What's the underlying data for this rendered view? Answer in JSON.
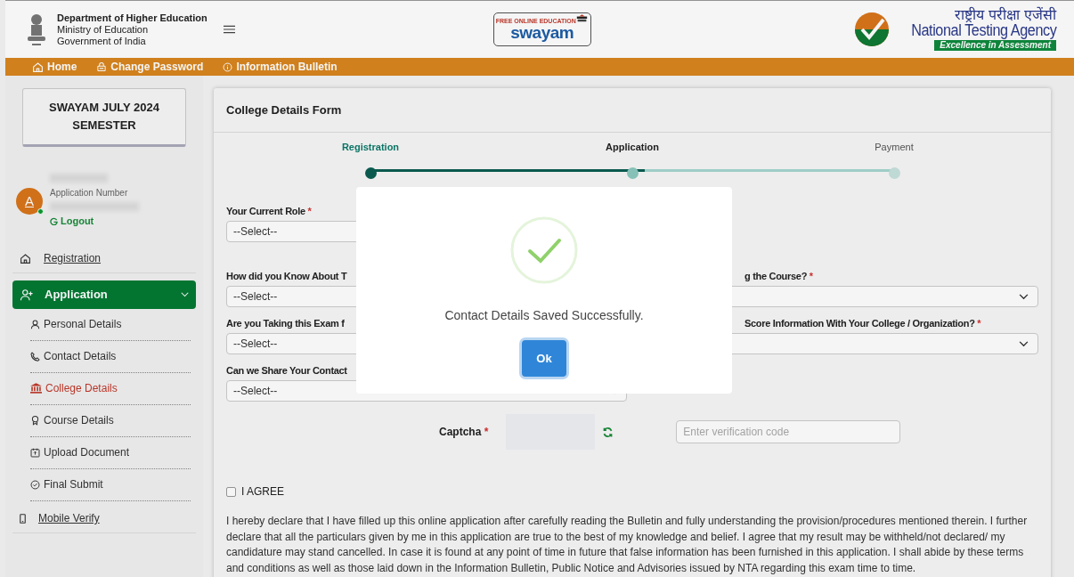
{
  "header": {
    "department": "Department of Higher Education",
    "ministry": "Ministry of Education",
    "government": "Government of India",
    "swayam_tagline": "FREE ONLINE EDUCATION",
    "swayam_name": "swayam",
    "nta_hindi": "राष्ट्रीय परीक्षा एजेंसी",
    "nta_name": "National Testing Agency",
    "nta_motto": "Excellence in Assessment"
  },
  "top_nav": [
    {
      "label": "Home"
    },
    {
      "label": "Change Password"
    },
    {
      "label": "Information Bulletin"
    }
  ],
  "sidebar": {
    "session": "SWAYAM JULY 2024 SEMESTER",
    "avatar_letter": "A",
    "online": true,
    "application_number_label": "Application Number",
    "logout": "Logout",
    "items": [
      {
        "label": "Registration",
        "selected": false
      },
      {
        "label": "Application",
        "selected": true,
        "expanded": true,
        "children": [
          {
            "label": "Personal Details",
            "selected": false
          },
          {
            "label": "Contact Details",
            "selected": false
          },
          {
            "label": "College Details",
            "selected": true
          },
          {
            "label": "Course Details",
            "selected": false
          },
          {
            "label": "Upload Document",
            "selected": false
          },
          {
            "label": "Final Submit",
            "selected": false
          }
        ]
      },
      {
        "label": "Mobile Verify",
        "selected": false
      }
    ]
  },
  "form": {
    "title": "College Details Form",
    "steps": [
      {
        "label": "Registration",
        "done": true,
        "selected": false
      },
      {
        "label": "Application",
        "done": false,
        "selected": true
      },
      {
        "label": "Payment",
        "done": false,
        "selected": false
      }
    ],
    "rows": [
      {
        "left_label": "Your Current Role",
        "left_mark": "*",
        "left_value": "--Select--"
      },
      {
        "left_label": "How did you Know About T",
        "left_value": "--Select--",
        "right_label": "g the Course?",
        "right_mark": "*"
      },
      {
        "left_label": "Are you Taking this Exam f",
        "left_value": "--Select--",
        "right_label": "Score Information With Your College / Organization?",
        "right_mark": "*"
      },
      {
        "left_label": "Can we Share Your Contact",
        "left_value": "--Select--"
      }
    ],
    "captcha_label": "Captcha",
    "captcha_mark": "*",
    "captcha_placeholder": "Enter verification code",
    "agree": {
      "label": "I AGREE",
      "checked": false
    },
    "declaration": "I hereby declare that I have filled up this online application after carefully reading the Bulletin and fully understanding the provision/procedures mentioned therein. I further declare that all the particulars given by me in this application are true to the best of my knowledge and belief. I agree that my result may be withheld/not declared/ my candidature may stand cancelled. In case it is found at any point of time in future that false information has been furnished in this application. I shall abide by these terms and conditions as well as those laid down in the Information Bulletin, Public Notice and Advisories issued by NTA regarding this exam time to time."
  },
  "modal": {
    "message": "Contact Details Saved Successfully.",
    "button": "Ok"
  }
}
